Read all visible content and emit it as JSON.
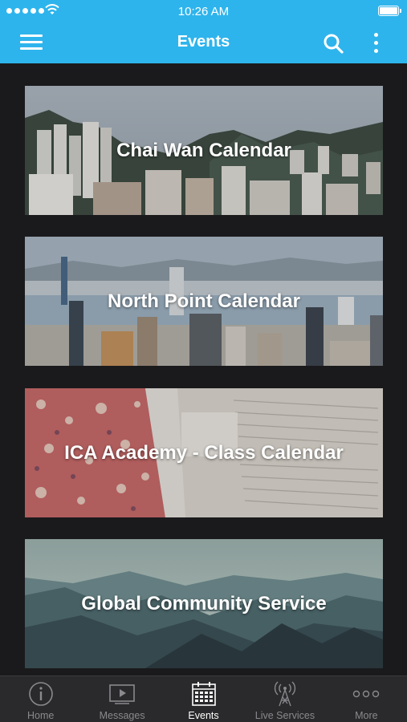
{
  "status_bar": {
    "time": "10:26 AM"
  },
  "header": {
    "title": "Events",
    "icons": [
      "hamburger-menu-icon",
      "search-icon",
      "more-vertical-icon"
    ]
  },
  "events": [
    {
      "name": "Chai Wan Calendar"
    },
    {
      "name": "North Point Calendar"
    },
    {
      "name": "ICA Academy - Class Calendar"
    },
    {
      "name": "Global Community Service"
    }
  ],
  "tabbar": {
    "active": "Events",
    "tabs": [
      {
        "label": "Home",
        "icon": "info-circle-icon"
      },
      {
        "label": "Messages",
        "icon": "video-play-icon"
      },
      {
        "label": "Events",
        "icon": "calendar-icon"
      },
      {
        "label": "Live Services",
        "icon": "broadcast-tower-icon"
      },
      {
        "label": "More",
        "icon": "more-horizontal-icon"
      }
    ]
  },
  "colors": {
    "header_bg": "#2eb4ec",
    "content_bg": "#1a1a1c",
    "tabbar_bg": "#2a2a2c",
    "tab_inactive": "#8a8a8e",
    "tab_active": "#ffffff"
  }
}
